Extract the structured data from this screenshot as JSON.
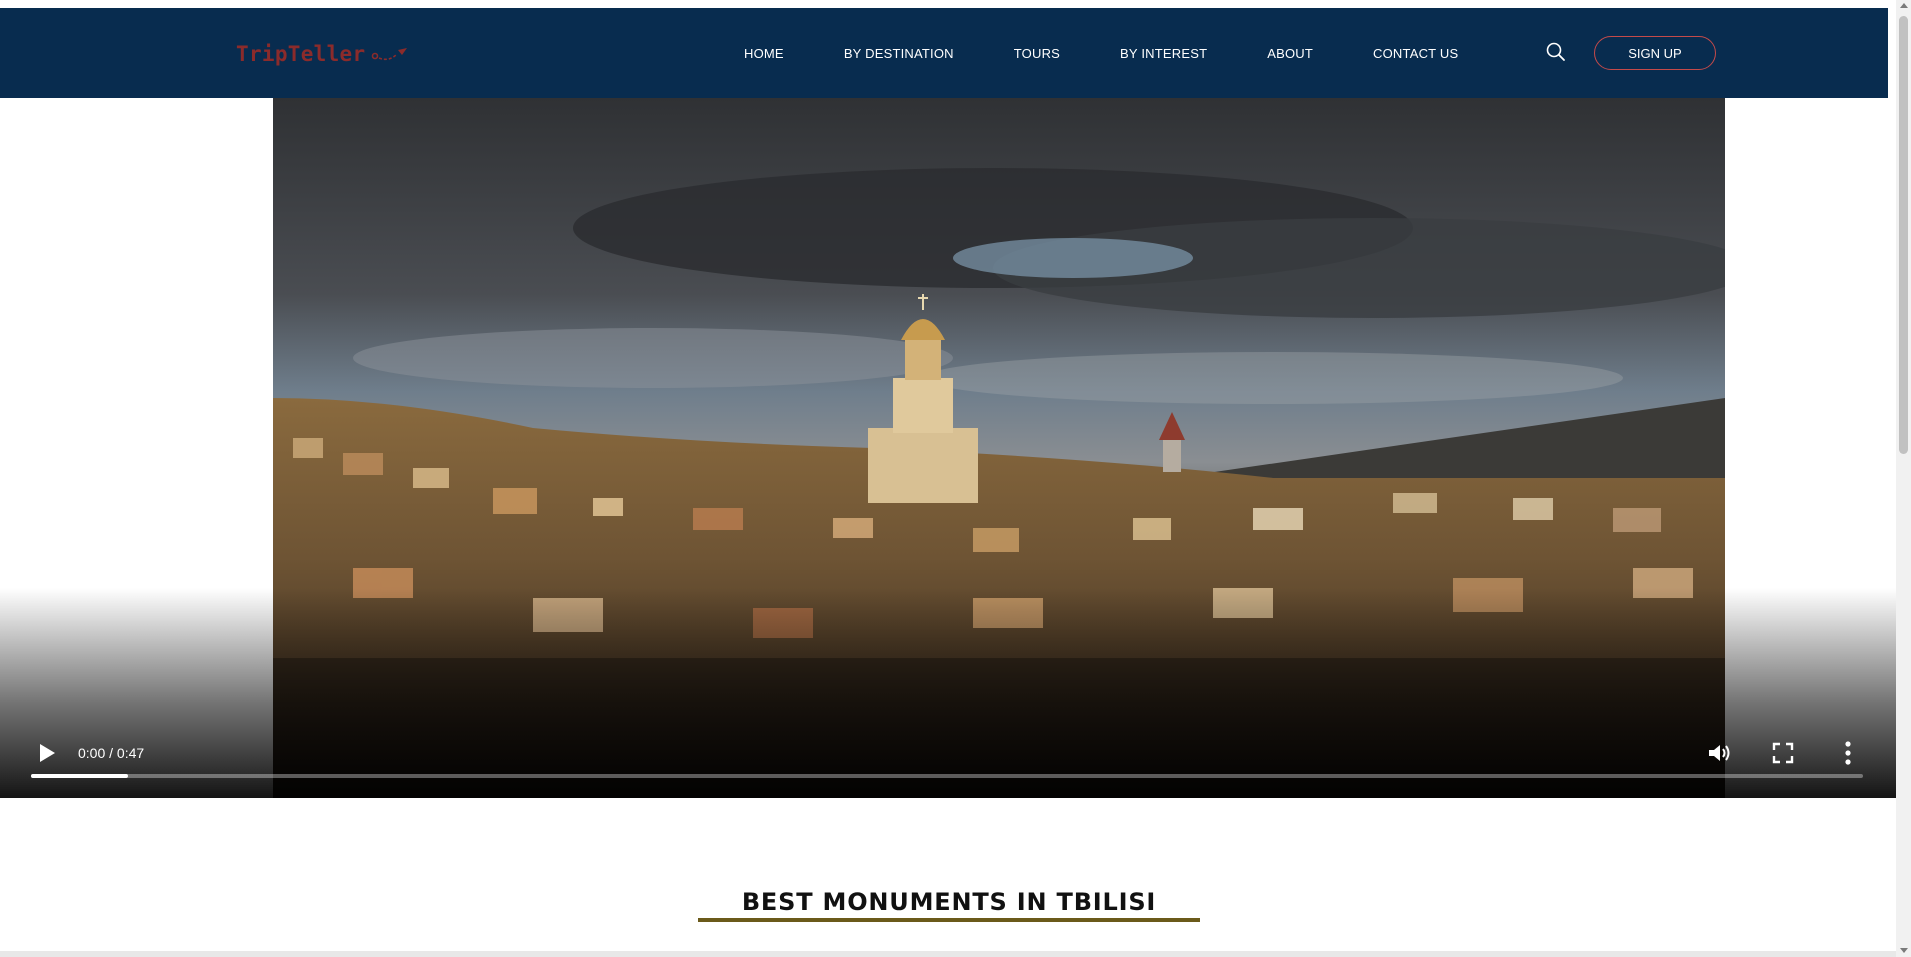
{
  "header": {
    "logo_text": "TripTeller",
    "nav": [
      "HOME",
      "BY DESTINATION",
      "TOURS",
      "BY INTEREST",
      "ABOUT",
      "CONTACT US"
    ],
    "signup_label": "SIGN UP",
    "colors": {
      "background": "#082c4f",
      "logo": "#8b2b2b",
      "signup_border": "#c44a4a"
    }
  },
  "video": {
    "time": "0:00 / 0:47",
    "progress_buffered_fraction": 0.053,
    "icons": [
      "play-icon",
      "volume-icon",
      "fullscreen-icon",
      "more-vertical-icon"
    ]
  },
  "section": {
    "title": "BEST MONUMENTS IN TBILISI",
    "underline_color": "#6b5a1a"
  },
  "icons": {
    "search": "search-icon",
    "logo_mark": "plane-path-icon"
  }
}
